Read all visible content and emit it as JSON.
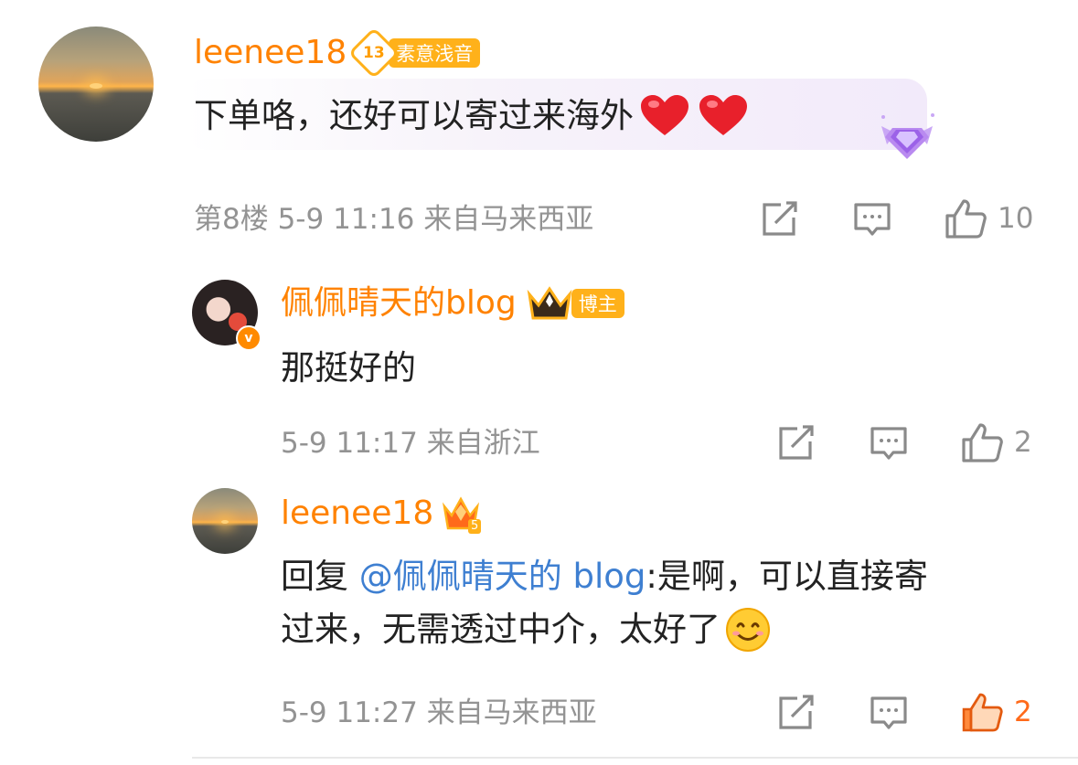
{
  "comments": [
    {
      "username": "leenee18",
      "level_badge": "13",
      "badge_text": "素意浅音",
      "text": "下单咯，还好可以寄过来海外",
      "emoji": "❤️ ❤️",
      "meta": "第8楼 5-9 11:16 来自马来西亚",
      "likes": "10"
    },
    {
      "username": "佩佩晴天的blog",
      "badge_text": "博主",
      "text": "那挺好的",
      "meta": "5-9 11:17 来自浙江",
      "likes": "2"
    },
    {
      "username": "leenee18",
      "crown_level": "5",
      "reply_prefix": "回复 ",
      "mention": "@佩佩晴天的 blog",
      "text_line1": ":是啊，可以直接寄",
      "text_line2": "过来，无需透过中介，太好了",
      "meta": "5-9 11:27 来自马来西亚",
      "likes": "2"
    }
  ],
  "colors": {
    "username": "#ff8200",
    "meta": "#939393",
    "mention": "#3e7fd1",
    "liked": "#ff6a1a"
  },
  "icons": [
    "repost-icon",
    "comment-icon",
    "thumbs-up-icon",
    "heart-icon",
    "smile-emoji-icon",
    "diamond-badge-icon",
    "crown-badge-icon"
  ]
}
